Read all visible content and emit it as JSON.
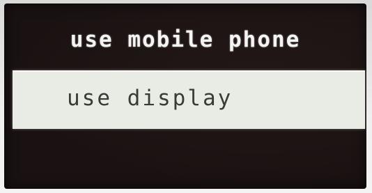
{
  "screen": {
    "title": "use mobile phone",
    "menu": {
      "items": [
        {
          "label": "use display",
          "selected": true
        }
      ]
    }
  },
  "colors": {
    "screen_background": "#1a1212",
    "title_text": "#f4f4f2",
    "selection_background": "#e9ece4",
    "selection_text": "#3a3a36"
  }
}
